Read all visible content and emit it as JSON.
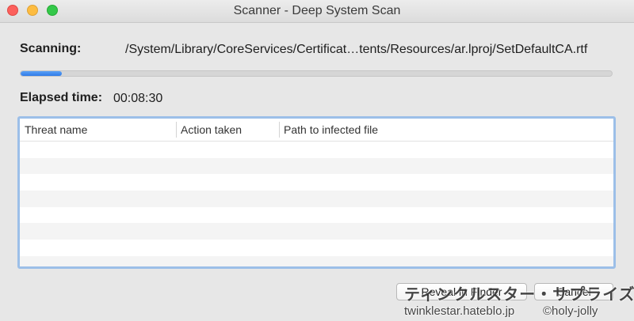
{
  "window": {
    "title": "Scanner - Deep System Scan"
  },
  "scan": {
    "label": "Scanning:",
    "path": "/System/Library/CoreServices/Certificat…tents/Resources/ar.lproj/SetDefaultCA.rtf",
    "progress_percent": 7
  },
  "elapsed": {
    "label": "Elapsed time:",
    "value": "00:08:30"
  },
  "table": {
    "columns": [
      "Threat name",
      "Action taken",
      "Path to infected file"
    ],
    "rows": []
  },
  "buttons": {
    "reveal": "Reveal in Finder",
    "cancel": "Cancel"
  },
  "watermark": {
    "jp": "ティンクルスター・サプライズ",
    "site": "twinklestar.hateblo.jp",
    "copyright": "©holy-jolly"
  },
  "colors": {
    "progress": "#2f7be8",
    "table_focus_border": "#9cbfe8"
  }
}
